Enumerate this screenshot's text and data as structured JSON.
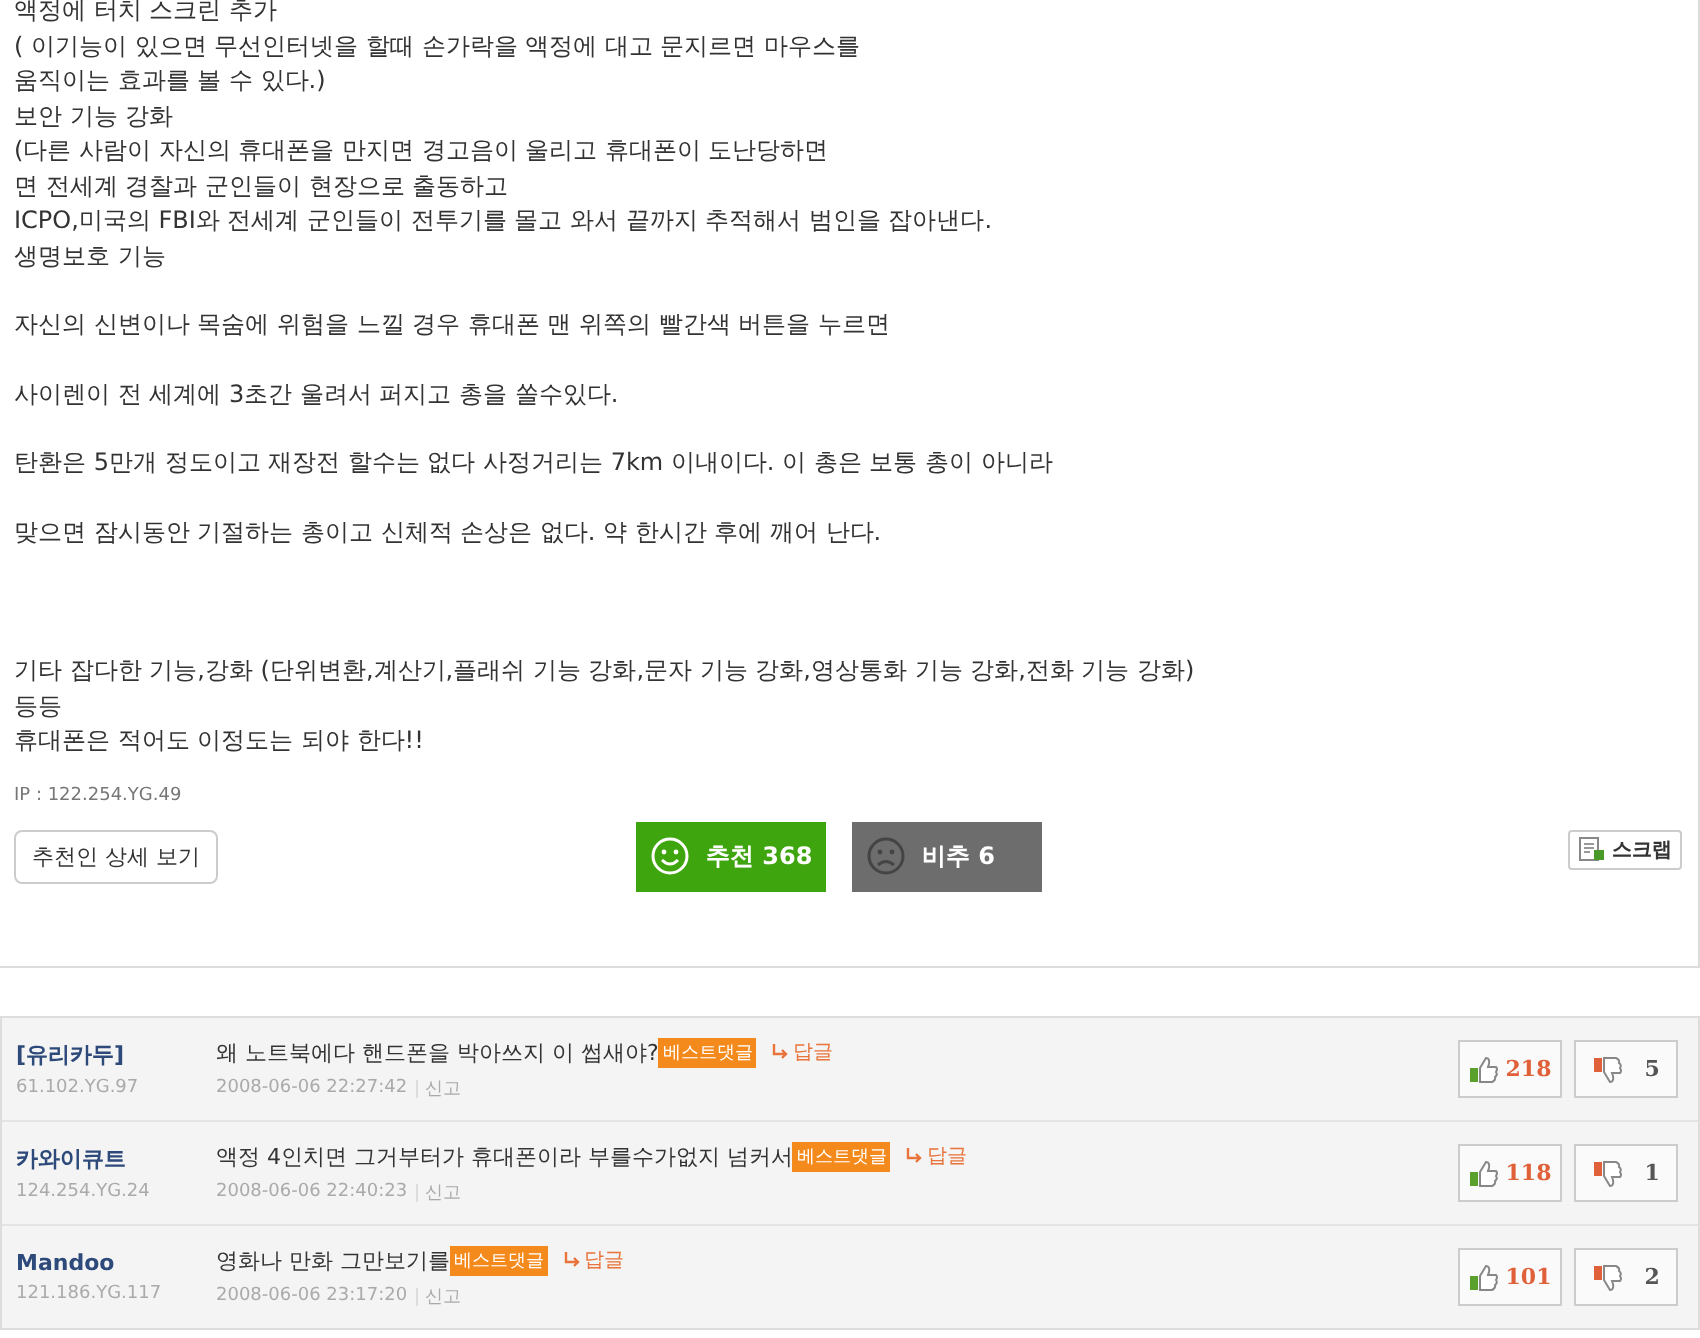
{
  "article": {
    "blocks": [
      [
        "액정에 터치 스크린 추가",
        "( 이기능이 있으면 무선인터넷을 할때 손가락을 액정에 대고 문지르면 마우스를",
        "움직이는 효과를 볼 수 있다.)",
        "보안 기능 강화",
        "(다른 사람이 자신의 휴대폰을 만지면 경고음이 울리고 휴대폰이 도난당하면",
        "면 전세계 경찰과 군인들이 현장으로 출동하고",
        "ICPO,미국의 FBI와 전세계 군인들이 전투기를 몰고 와서 끝까지 추적해서 범인을 잡아낸다.",
        "생명보호 기능"
      ],
      [
        "자신의 신변이나 목숨에 위험을 느낄 경우 휴대폰 맨 위쪽의 빨간색 버튼을 누르면"
      ],
      [
        "사이렌이 전 세계에 3초간 울려서 퍼지고 총을 쏠수있다."
      ],
      [
        "탄환은 5만개 정도이고 재장전 할수는 없다  사정거리는 7km 이내이다. 이 총은 보통 총이 아니라"
      ],
      [
        "맞으면 잠시동안 기절하는 총이고 신체적 손상은 없다. 약 한시간 후에 깨어 난다."
      ],
      [
        "기타 잡다한 기능,강화 (단위변환,계산기,플래쉬 기능 강화,문자 기능 강화,영상통화 기능 강화,전화 기능 강화)",
        "등등",
        "휴대폰은 적어도 이정도는 되야 한다!!"
      ]
    ],
    "ip": "IP : 122.254.YG.49",
    "recommenders_button": "추천인 상세 보기",
    "recommend_button": "추천 368",
    "oppose_button": "비추 6",
    "scrap_button": "스크랩"
  },
  "comments": [
    {
      "author": "[유리카두]",
      "ip": "61.102.YG.97",
      "text": "왜 노트북에다 핸드폰을 박아쓰지 이 썹새야?",
      "badge": "베스트댓글",
      "reply": "답글",
      "date": "2008-06-06 22:27:42",
      "report": "신고",
      "likes": "218",
      "dislikes": "5"
    },
    {
      "author": "카와이큐트",
      "ip": "124.254.YG.24",
      "text": "액정 4인치면 그거부터가 휴대폰이라 부를수가없지 넘커서",
      "badge": "베스트댓글",
      "reply": "답글",
      "date": "2008-06-06 22:40:23",
      "report": "신고",
      "likes": "118",
      "dislikes": "1"
    },
    {
      "author": "Mandoo",
      "ip": "121.186.YG.117",
      "text": "영화나 만화 그만보기를",
      "badge": "베스트댓글",
      "reply": "답글",
      "date": "2008-06-06 23:17:20",
      "report": "신고",
      "likes": "101",
      "dislikes": "2"
    }
  ]
}
